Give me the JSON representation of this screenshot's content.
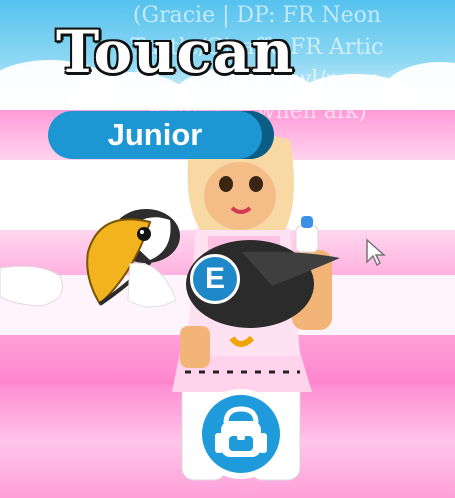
{
  "background_overhead_name": [
    "(Gracie | DP: FR Neon",
    "Turtle/Giraffe FR Artic",
    "R... ... Snow Owl/neon",
    "Rain! | ... when afk)"
  ],
  "pet_name": "Toucan",
  "age_badge": {
    "label": "Junior",
    "color": "#1c97d4"
  },
  "interact_prompt": {
    "key_label": "E",
    "color": "#1e88c8"
  },
  "backpack_button": {
    "icon": "backpack-icon",
    "color": "#1f9bdc"
  },
  "cursor": {
    "icon": "arrow-cursor-icon"
  }
}
